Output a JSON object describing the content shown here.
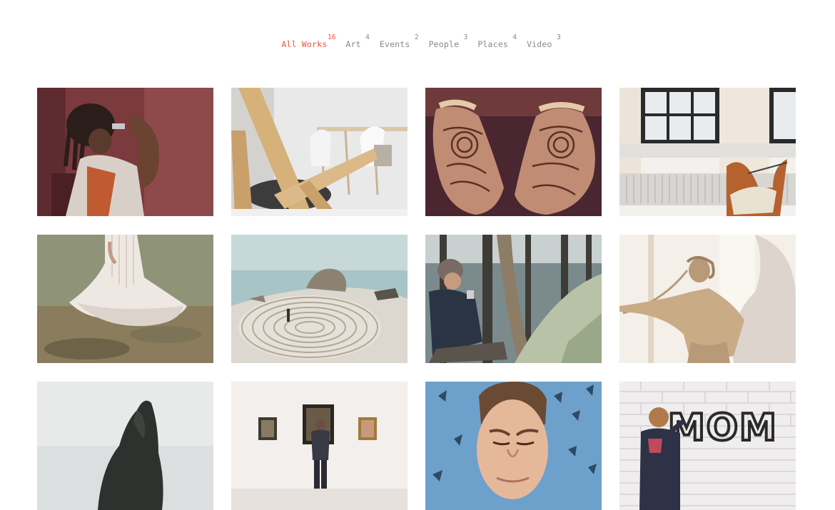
{
  "filters": [
    {
      "label": "All Works",
      "count": "16",
      "active": true
    },
    {
      "label": "Art",
      "count": "4"
    },
    {
      "label": "Events",
      "count": "2"
    },
    {
      "label": "People",
      "count": "3"
    },
    {
      "label": "Places",
      "count": "4"
    },
    {
      "label": "Video",
      "count": "3"
    }
  ],
  "works": [
    {
      "subject": "man with dreadlocks against red wall"
    },
    {
      "subject": "wooden chair and white dining chairs"
    },
    {
      "subject": "hands with henna"
    },
    {
      "subject": "leather chair by window"
    },
    {
      "subject": "woman in white dress in water"
    },
    {
      "subject": "stone labyrinth on beach"
    },
    {
      "subject": "camper with tent in forest"
    },
    {
      "subject": "classical statue"
    },
    {
      "subject": "sea stack rock"
    },
    {
      "subject": "gallery visitor viewing paintings"
    },
    {
      "subject": "man squinting with blue background"
    },
    {
      "subject": "child spraying MOM graffiti on brick wall"
    }
  ],
  "graffiti_text": "MOM"
}
